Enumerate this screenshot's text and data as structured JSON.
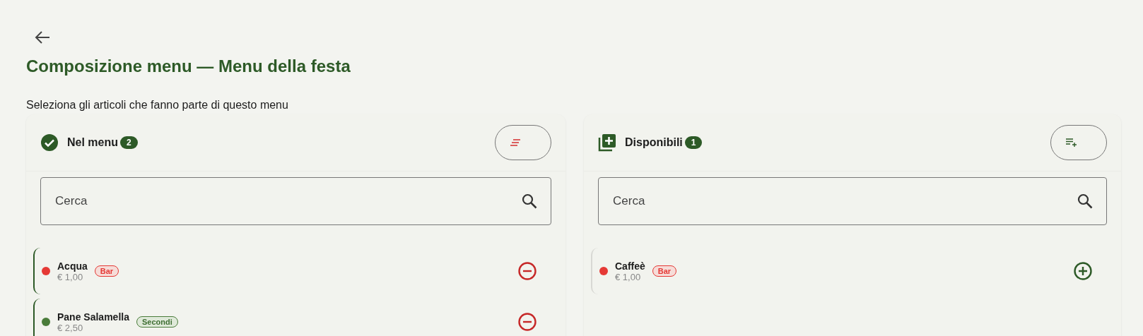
{
  "header": {
    "title": "Composizione menu — Menu della festa",
    "subtitle": "Seleziona gli articoli che fanno parte di questo menu"
  },
  "panels": [
    {
      "kind": "in_menu",
      "title": "Nel menu",
      "count": "2",
      "search": {
        "placeholder": "Cerca"
      },
      "items": [
        {
          "name": "Acqua",
          "price": "€ 1,00",
          "category": "Bar",
          "color": "#e53935"
        },
        {
          "name": "Pane Salamella",
          "price": "€ 2,50",
          "category": "Secondi",
          "color": "#4a7c3a"
        }
      ]
    },
    {
      "kind": "available",
      "title": "Disponibili",
      "count": "1",
      "search": {
        "placeholder": "Cerca"
      },
      "items": [
        {
          "name": "Caffeè",
          "price": "€ 1,00",
          "category": "Bar",
          "color": "#e53935"
        }
      ]
    }
  ]
}
